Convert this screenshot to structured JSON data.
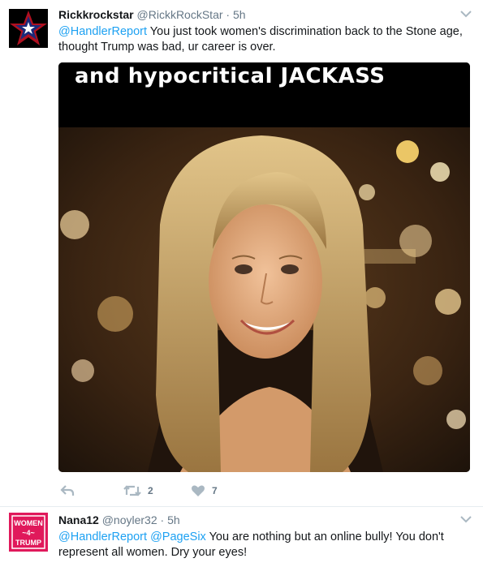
{
  "tweets": [
    {
      "name": "Rickkrockstar",
      "handle": "@RickkRockStar",
      "separator": "·",
      "time": "5h",
      "mention": "@HandlerReport",
      "text": " You just took women's discrimination back to the Stone age, thought Trump was bad, ur career is over.",
      "media_caption": "and hypocritical JACKASS",
      "retweet_count": "2",
      "like_count": "7",
      "avatar_icon": "star-icon"
    },
    {
      "name": "Nana12",
      "handle": "@noyler32",
      "separator": "·",
      "time": "5h",
      "mention_1": "@HandlerReport",
      "mention_2": "@PageSix",
      "text": " You are nothing but an online bully! You don't represent all women. Dry your eyes!",
      "avatar_text": [
        "WOMEN",
        "~4~",
        "TRUMP"
      ]
    }
  ],
  "colors": {
    "link": "#1da1f2",
    "secondary": "#657786",
    "primary": "#14171a",
    "divider": "#e6ecf0"
  }
}
